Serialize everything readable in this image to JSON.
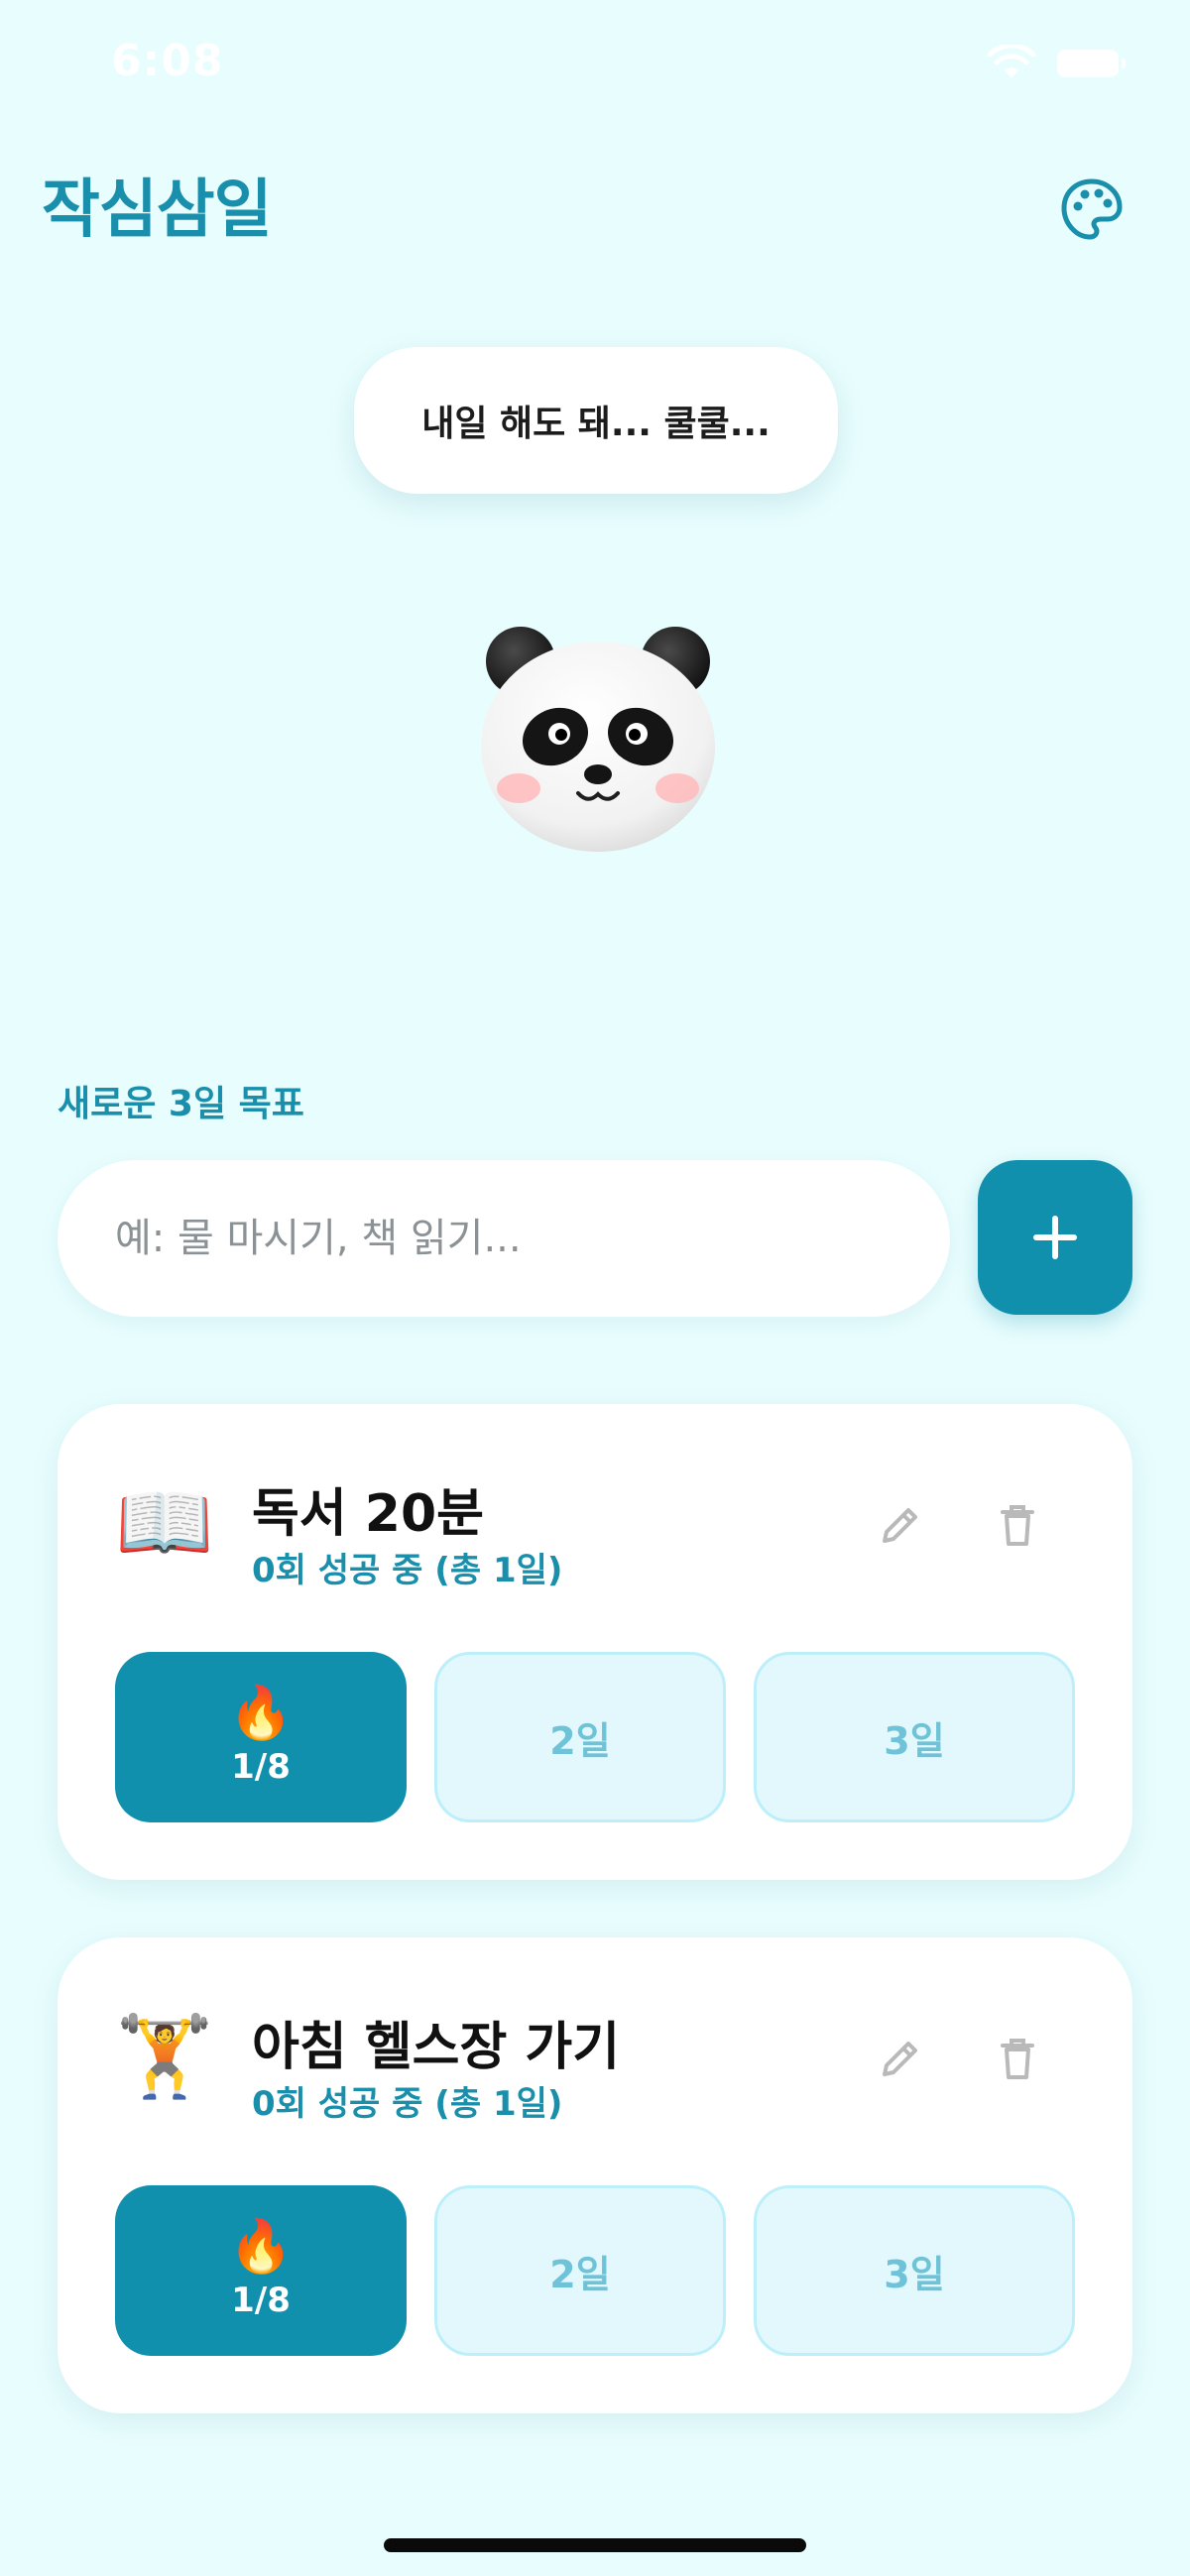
{
  "status_bar": {
    "time": "6:08"
  },
  "header": {
    "title": "작심삼일",
    "palette_icon": "palette-icon"
  },
  "mascot": {
    "speech": "내일 해도 돼... 쿨쿨...",
    "icon": "panda-icon"
  },
  "new_goal": {
    "section_label": "새로운 3일 목표",
    "placeholder": "예: 물 마시기, 책 읽기...",
    "value": "",
    "add_icon": "plus-icon"
  },
  "colors": {
    "accent": "#1190ad",
    "background": "#e8fdfe",
    "pending_day": "#e2f8fc",
    "text_accent": "#1a8fac"
  },
  "habits": [
    {
      "emoji": "📖",
      "title": "독서 20분",
      "subtitle": "0회 성공 중 (총 1일)",
      "days": [
        {
          "emoji": "🔥",
          "label": "1/8",
          "state": "active"
        },
        {
          "label": "2일",
          "state": "pending"
        },
        {
          "label": "3일",
          "state": "pending"
        }
      ]
    },
    {
      "emoji": "🏋️",
      "title": "아침 헬스장 가기",
      "subtitle": "0회 성공 중 (총 1일)",
      "days": [
        {
          "emoji": "🔥",
          "label": "1/8",
          "state": "active"
        },
        {
          "label": "2일",
          "state": "pending"
        },
        {
          "label": "3일",
          "state": "pending"
        }
      ]
    }
  ]
}
